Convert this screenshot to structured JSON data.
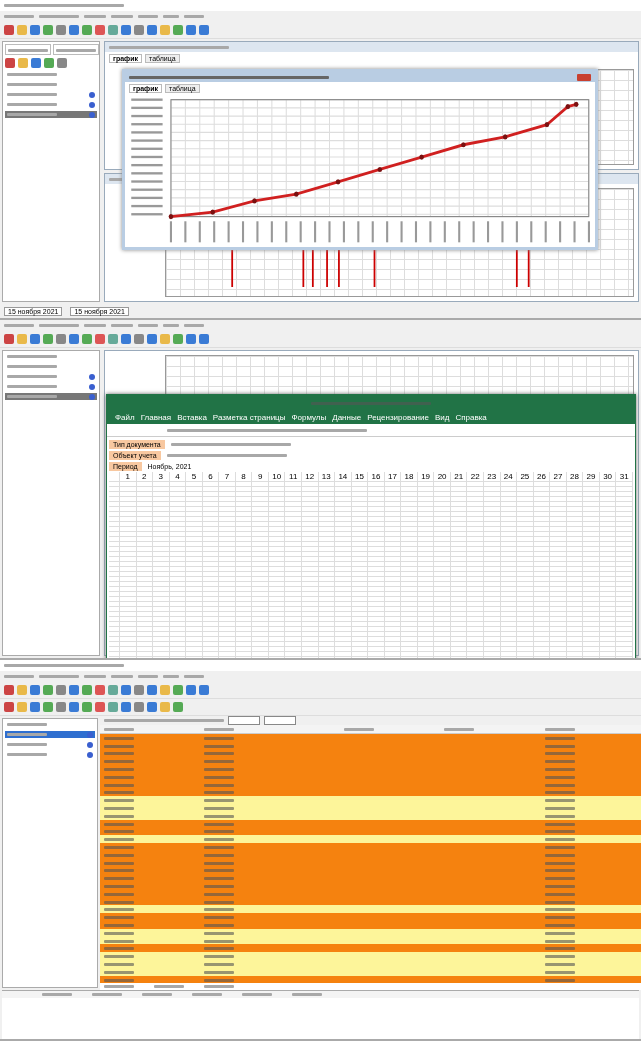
{
  "top_app": {
    "tabs": [
      {
        "label": "график",
        "selected": true
      },
      {
        "label": "таблица",
        "selected": false
      }
    ],
    "chart_window_tabs": [
      {
        "label": "график",
        "selected": true
      },
      {
        "label": "таблица",
        "selected": false
      }
    ],
    "tree": [
      {
        "selected": false
      },
      {
        "selected": false
      },
      {
        "selected": false
      },
      {
        "selected": false
      },
      {
        "selected": true
      }
    ],
    "date_from": "15 ноября 2021",
    "date_to": "15 ноября 2021"
  },
  "mid_app": {
    "tree": [
      {
        "selected": false
      },
      {
        "selected": false
      },
      {
        "selected": false
      },
      {
        "selected": false
      },
      {
        "selected": true
      }
    ]
  },
  "excel": {
    "ribbon": [
      "Файл",
      "Главная",
      "Вставка",
      "Разметка страницы",
      "Формулы",
      "Данные",
      "Рецензирование",
      "Вид",
      "Справка"
    ],
    "labels": [
      "Тип документа",
      "Объект учета",
      "Период"
    ],
    "period": "Ноябрь, 2021",
    "days": [
      "1",
      "2",
      "3",
      "4",
      "5",
      "6",
      "7",
      "8",
      "9",
      "10",
      "11",
      "12",
      "13",
      "14",
      "15",
      "16",
      "17",
      "18",
      "19",
      "20",
      "21",
      "22",
      "23",
      "24",
      "25",
      "26",
      "27",
      "28",
      "29",
      "30",
      "31"
    ]
  },
  "events": {
    "tree": [
      {
        "selected": false
      },
      {
        "selected": true
      },
      {
        "selected": false
      },
      {
        "selected": false
      }
    ],
    "rows": [
      {
        "color": "#f5820f"
      },
      {
        "color": "#f5820f"
      },
      {
        "color": "#f5820f"
      },
      {
        "color": "#f5820f"
      },
      {
        "color": "#f5820f"
      },
      {
        "color": "#f5820f"
      },
      {
        "color": "#f5820f"
      },
      {
        "color": "#f5820f"
      },
      {
        "color": "#fdf59a"
      },
      {
        "color": "#fdf59a"
      },
      {
        "color": "#fdf59a"
      },
      {
        "color": "#f5820f"
      },
      {
        "color": "#f5820f"
      },
      {
        "color": "#fdf59a"
      },
      {
        "color": "#f5820f"
      },
      {
        "color": "#f5820f"
      },
      {
        "color": "#f5820f"
      },
      {
        "color": "#f5820f"
      },
      {
        "color": "#f5820f"
      },
      {
        "color": "#f5820f"
      },
      {
        "color": "#f5820f"
      },
      {
        "color": "#f5820f"
      },
      {
        "color": "#fdf59a"
      },
      {
        "color": "#f5820f"
      },
      {
        "color": "#f5820f"
      },
      {
        "color": "#fdf59a"
      },
      {
        "color": "#fdf59a"
      },
      {
        "color": "#f5820f"
      },
      {
        "color": "#fdf59a"
      },
      {
        "color": "#fdf59a"
      },
      {
        "color": "#fdf59a"
      },
      {
        "color": "#f5820f"
      }
    ]
  }
}
